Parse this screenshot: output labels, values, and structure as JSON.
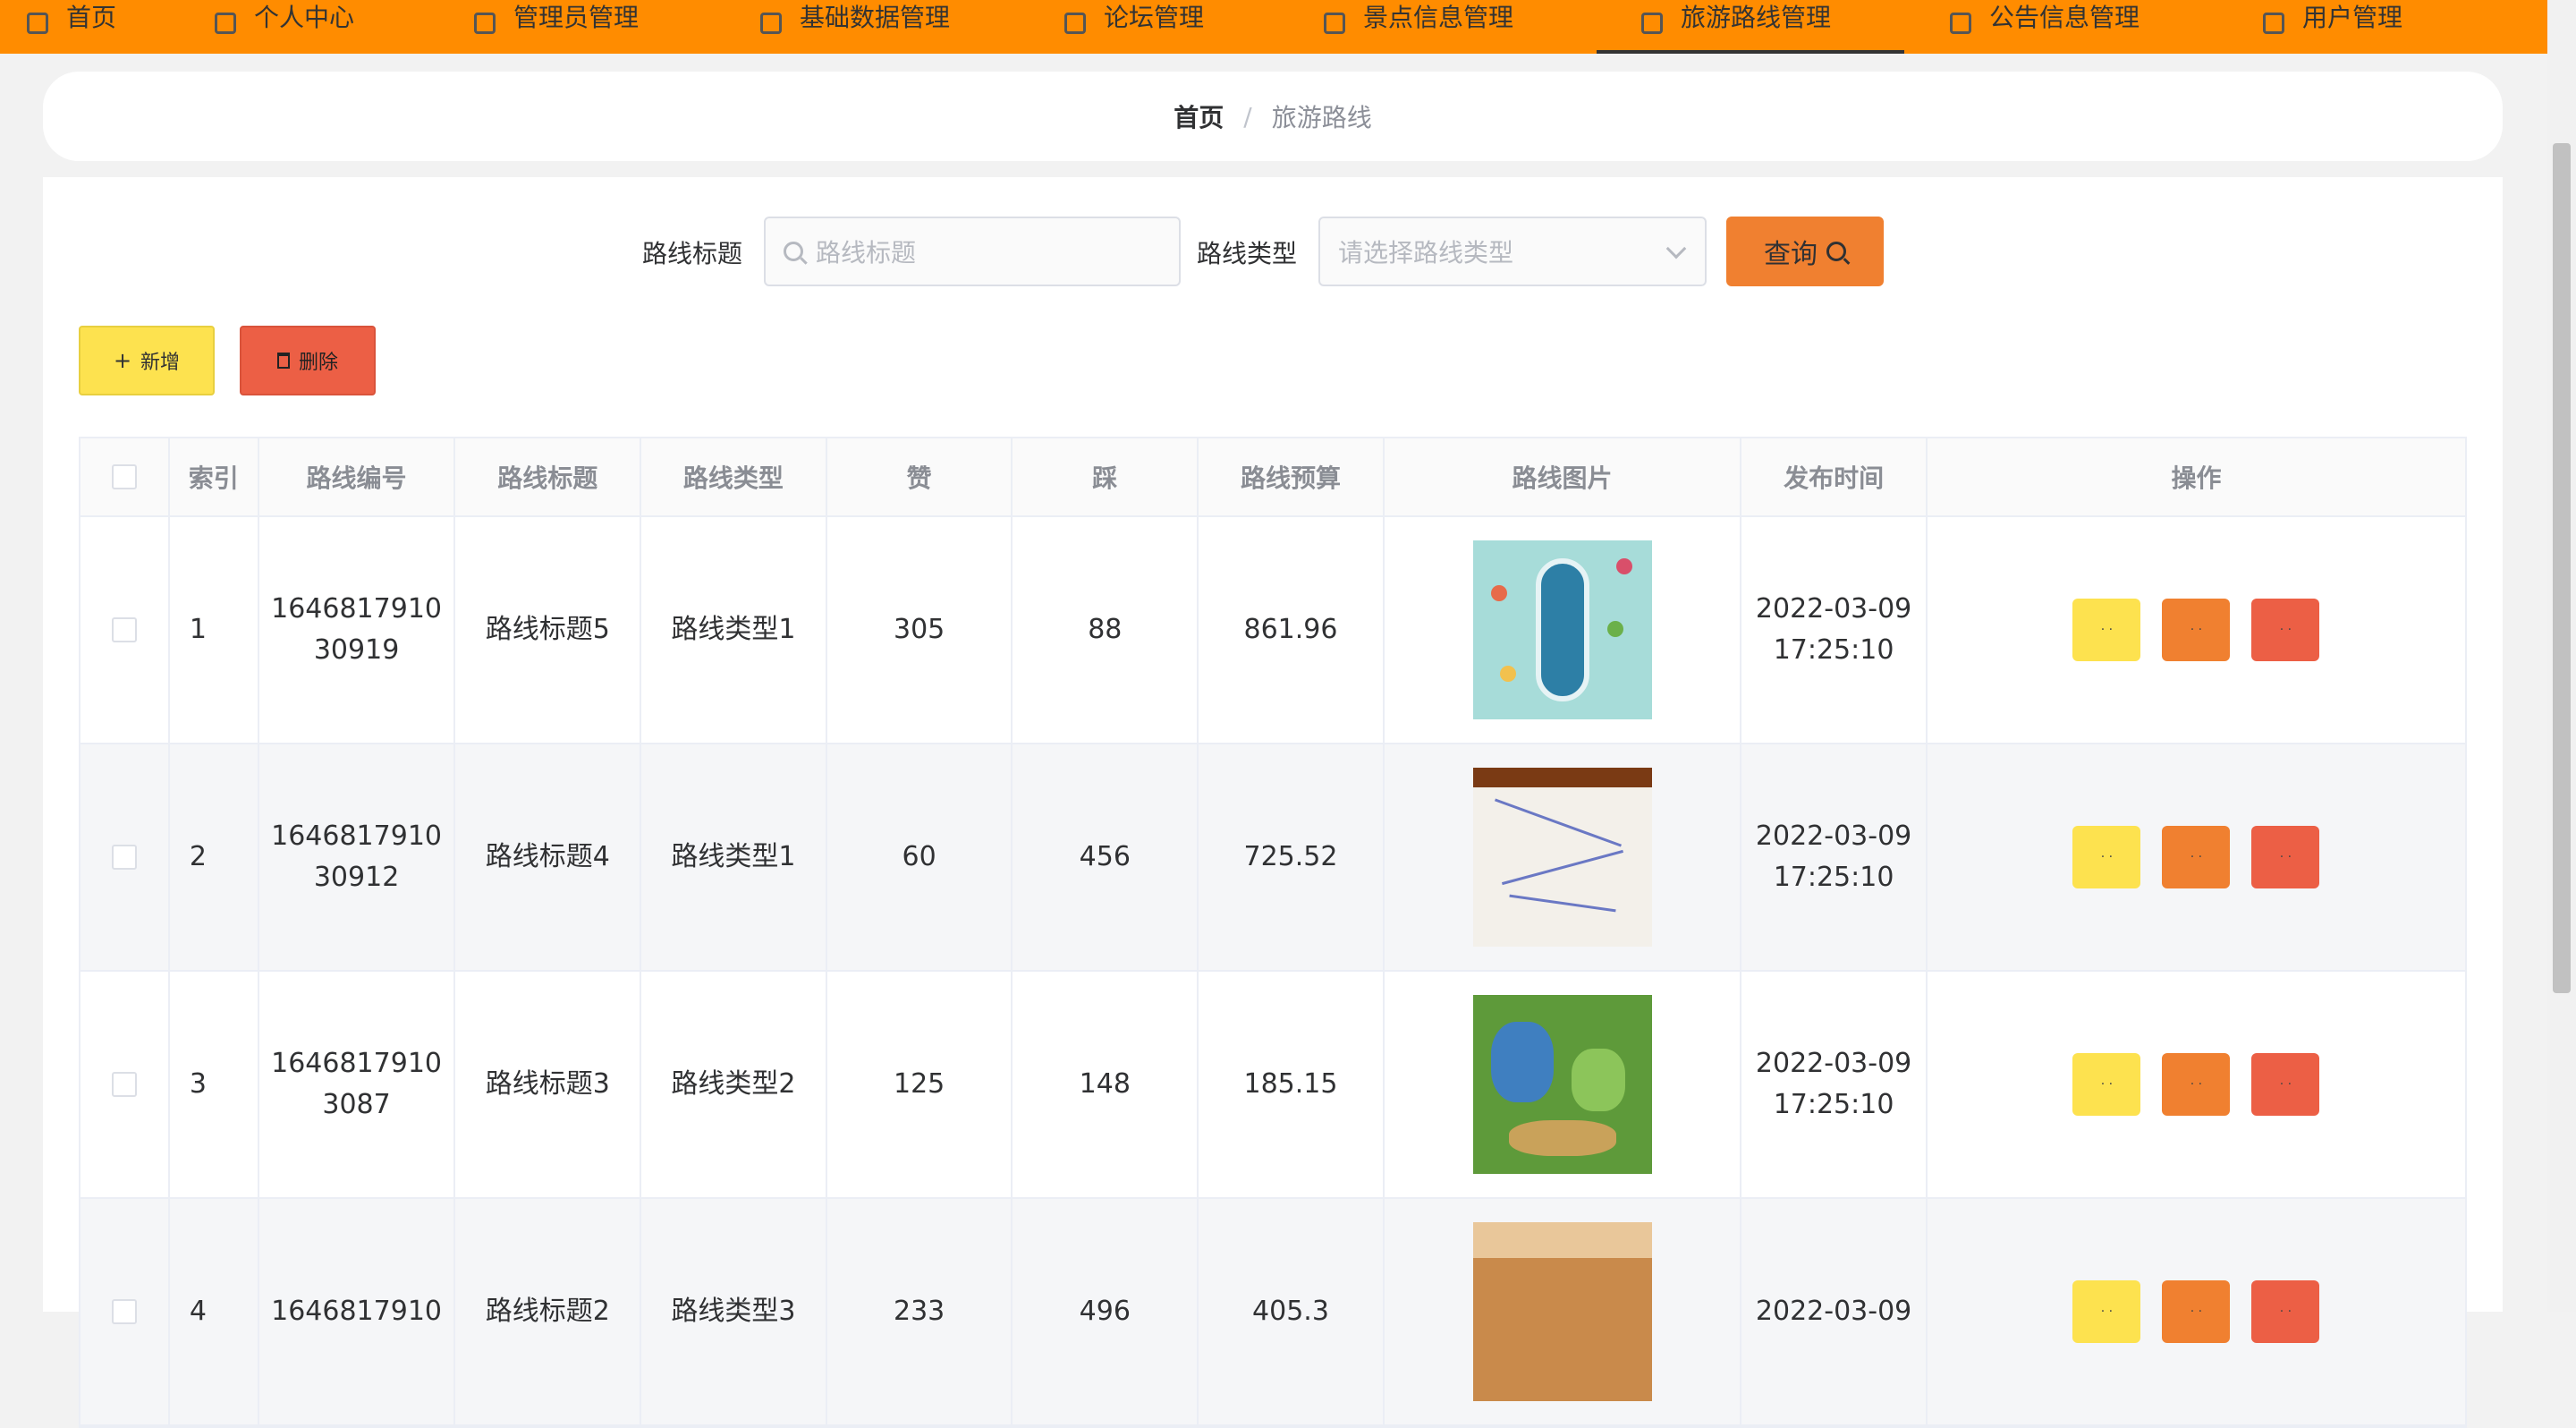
{
  "nav": {
    "items": [
      {
        "label": "首页"
      },
      {
        "label": "个人中心"
      },
      {
        "label": "管理员管理"
      },
      {
        "label": "基础数据管理"
      },
      {
        "label": "论坛管理"
      },
      {
        "label": "景点信息管理"
      },
      {
        "label": "旅游路线管理"
      },
      {
        "label": "公告信息管理"
      },
      {
        "label": "用户管理"
      }
    ],
    "active_index": 6
  },
  "breadcrumb": {
    "home": "首页",
    "separator": "/",
    "current": "旅游路线"
  },
  "search": {
    "title_label": "路线标题",
    "title_placeholder": "路线标题",
    "type_label": "路线类型",
    "type_placeholder": "请选择路线类型",
    "query_label": "查询"
  },
  "toolbar": {
    "add_label": "新增",
    "delete_label": "删除"
  },
  "table": {
    "headers": [
      "索引",
      "路线编号",
      "路线标题",
      "路线类型",
      "赞",
      "踩",
      "路线预算",
      "路线图片",
      "发布时间",
      "操作"
    ],
    "rows": [
      {
        "index": "1",
        "code_line1": "1646817910",
        "code_line2": "30919",
        "title": "路线标题5",
        "type": "路线类型1",
        "likes": "305",
        "dislikes": "88",
        "budget": "861.96",
        "date": "2022-03-09",
        "time": "17:25:10",
        "image": "lake-map-image"
      },
      {
        "index": "2",
        "code_line1": "1646817910",
        "code_line2": "30912",
        "title": "路线标题4",
        "type": "路线类型1",
        "likes": "60",
        "dislikes": "456",
        "budget": "725.52",
        "date": "2022-03-09",
        "time": "17:25:10",
        "image": "route-map-image"
      },
      {
        "index": "3",
        "code_line1": "1646817910",
        "code_line2": "3087",
        "title": "路线标题3",
        "type": "路线类型2",
        "likes": "125",
        "dislikes": "148",
        "budget": "185.15",
        "date": "2022-03-09",
        "time": "17:25:10",
        "image": "park-map-image"
      },
      {
        "index": "4",
        "code_line1": "1646817910",
        "code_line2": "",
        "title": "路线标题2",
        "type": "路线类型3",
        "likes": "233",
        "dislikes": "496",
        "budget": "405.3",
        "date": "2022-03-09",
        "time": "",
        "image": "old-map-image"
      }
    ]
  },
  "colors": {
    "nav": "#ff8c00",
    "query": "#f08030",
    "add": "#fde24f",
    "delete": "#ec5f45"
  }
}
